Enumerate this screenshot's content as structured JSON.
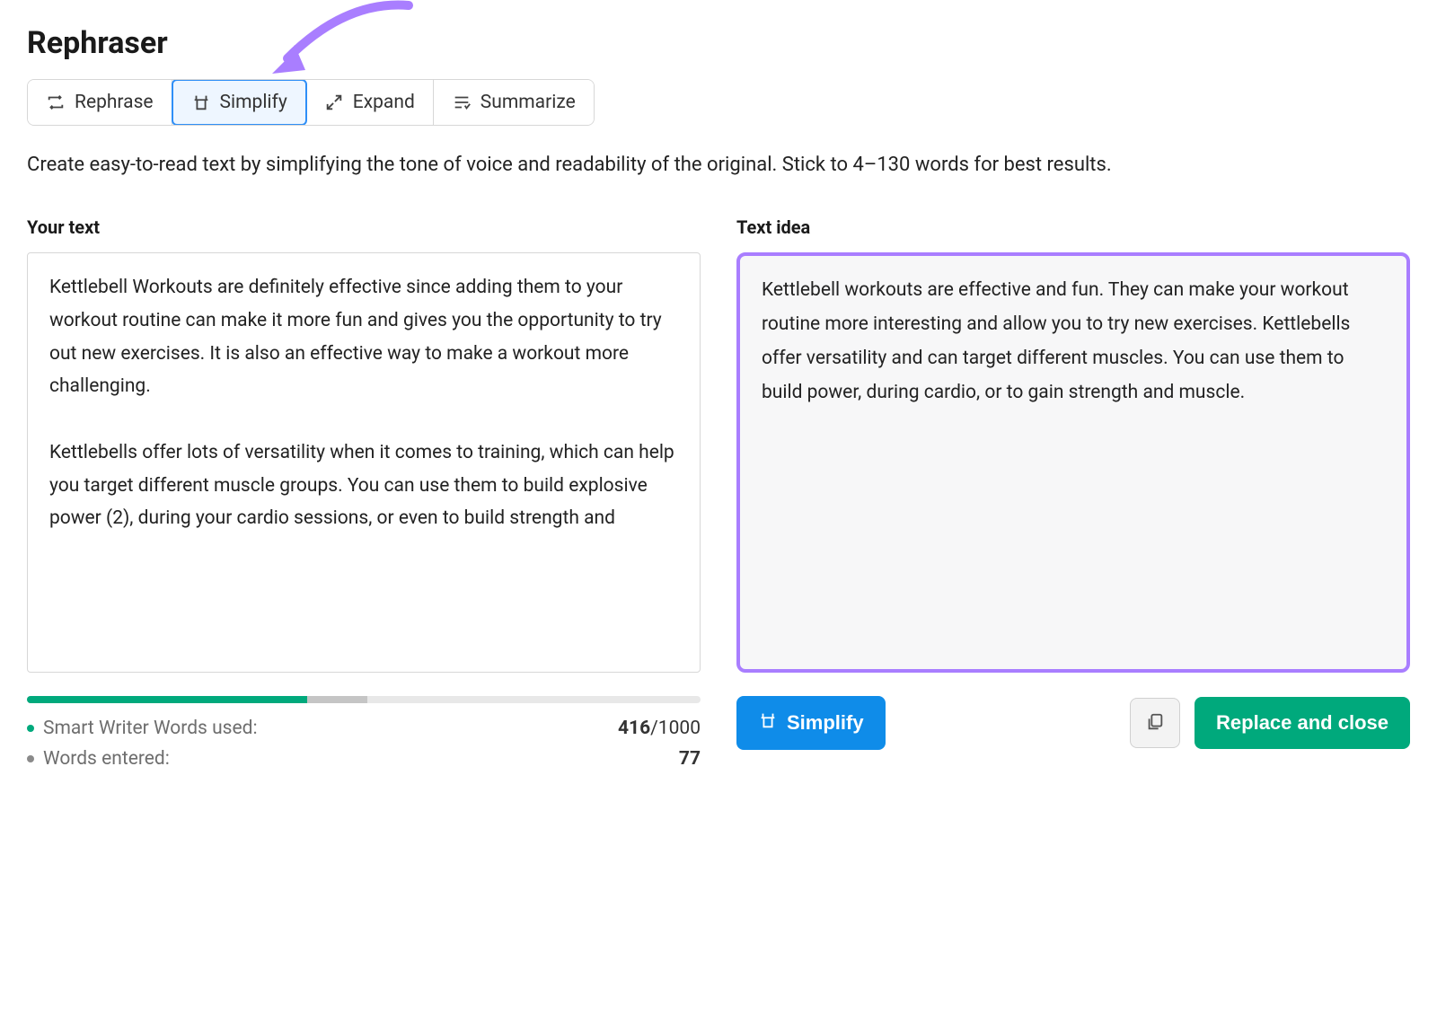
{
  "title": "Rephraser",
  "tabs": [
    {
      "id": "rephrase",
      "label": "Rephrase",
      "icon": "rephrase-icon"
    },
    {
      "id": "simplify",
      "label": "Simplify",
      "icon": "simplify-icon",
      "selected": true
    },
    {
      "id": "expand",
      "label": "Expand",
      "icon": "expand-icon"
    },
    {
      "id": "summarize",
      "label": "Summarize",
      "icon": "summarize-icon"
    }
  ],
  "description": "Create easy-to-read text by simplifying the tone of voice and readability of the original. Stick to 4–130 words for best results.",
  "leftPanel": {
    "label": "Your text",
    "content": "Kettlebell Workouts are definitely effective since adding them to your workout routine can make it more fun and gives you the opportunity to try out new exercises. It is also an effective way to make a workout more challenging.\n\nKettlebells offer lots of versatility when it comes to training, which can help you target different muscle groups. You can use them to build explosive power (2), during your cardio sessions, or even to build strength and"
  },
  "rightPanel": {
    "label": "Text idea",
    "content": "Kettlebell workouts are effective and fun. They can make your workout routine more interesting and allow you to try new exercises. Kettlebells offer versatility and can target different muscles. You can use them to build power, during cardio, or to gain strength and muscle."
  },
  "stats": {
    "wordsUsedLabel": "Smart Writer Words used:",
    "wordsUsedValue": "416",
    "wordsUsedMax": "/1000",
    "wordsEnteredLabel": "Words entered:",
    "wordsEnteredValue": "77"
  },
  "actions": {
    "simplifyLabel": "Simplify",
    "replaceLabel": "Replace and close"
  }
}
